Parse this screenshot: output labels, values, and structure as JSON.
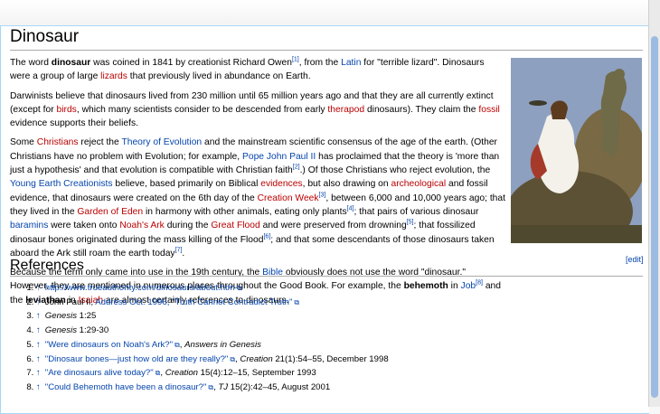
{
  "page": {
    "title": "Dinosaur"
  },
  "intro": {
    "p1_a": "The word ",
    "p1_b": "dinosaur",
    "p1_c": " was coined in 1841 by creationist Richard Owen",
    "p1_ref": "[1]",
    "p1_d": ", from the ",
    "p1_link_latin": "Latin",
    "p1_e": " for \"terrible lizard\". Dinosaurs were a group of large ",
    "p1_link_lizards": "lizards",
    "p1_f": " that previously lived in abundance on Earth.",
    "p2_a": "Darwinists believe that dinosaurs lived from 230 million until 65 million years ago and that they are all currently extinct (except for ",
    "p2_link_birds": "birds",
    "p2_b": ", which many scientists consider to be descended from early ",
    "p2_link_therapod": "therapod",
    "p2_c": " dinosaurs). They claim the ",
    "p2_link_fossil": "fossil",
    "p2_d": " evidence supports their beliefs.",
    "p3_a": "Some ",
    "p3_link_christians": "Christians",
    "p3_b": " reject the ",
    "p3_link_theory": "Theory of Evolution",
    "p3_c": " and the mainstream scientific consensus of the age of the earth. (Other Christians have no problem with Evolution; for example, ",
    "p3_link_pope": "Pope John Paul II",
    "p3_d": " has proclaimed that the theory is 'more than just a hypothesis' and that evolution is compatible with Christian faith",
    "p3_ref2": "[2]",
    "p3_e": ".) Of those Christians who reject evolution, the ",
    "p3_link_yec": "Young Earth Creationists",
    "p3_f": " believe, based primarily on Biblical ",
    "p3_link_evidences": "evidences",
    "p3_g": ", but also drawing on ",
    "p3_link_arch": "archeological",
    "p3_h": " and fossil evidence, that dinosaurs were created on the 6th day of the ",
    "p3_link_week": "Creation Week",
    "p3_ref3": "[3]",
    "p3_i": ", between 6,000 and 10,000 years ago; that they lived in the ",
    "p3_link_eden": "Garden of Eden",
    "p3_j": " in harmony with other animals, eating only plants",
    "p3_ref4": "[4]",
    "p3_k": "; that pairs of various dinosaur ",
    "p3_link_baramins": "baramins",
    "p3_l": " were taken onto ",
    "p3_link_ark": "Noah's Ark",
    "p3_m": " during the ",
    "p3_link_flood": "Great Flood",
    "p3_n": " and were preserved from drowning",
    "p3_ref5": "[5]",
    "p3_o": "; that fossilized dinosaur bones originated during the mass killing of the Flood",
    "p3_ref6": "[6]",
    "p3_p": "; and that some descendants of those dinosaurs taken aboard the Ark still roam the earth today",
    "p3_ref7": "[7]",
    "p3_q": ".",
    "p4_a": "Because the term only came into use in the 19th century, the ",
    "p4_link_bible": "Bible",
    "p4_b": " obviously does not use the word \"dinosaur.\" However, they are mentioned in numerous places throughout the Good Book. For example, the ",
    "p4_c": "behemoth",
    "p4_d": " in ",
    "p4_link_job": "Job",
    "p4_ref8": "[8]",
    "p4_e": " and the ",
    "p4_f": "leviathan",
    "p4_g": " in ",
    "p4_link_isaiah": "Isaiah",
    "p4_h": " are almost certainly references to dinosaurs."
  },
  "references": {
    "heading": "References",
    "edit_label": "[edit]",
    "arrow": "↑",
    "items": [
      {
        "link": "http://www.trueauthority.com/dinosaurs/about.htm"
      },
      {
        "pre": "John Paul II, ",
        "link": "Address Oct. 1996, \"Truth Cannot Contradict Truth\""
      },
      {
        "pre": "Genesis",
        "post": " 1:25"
      },
      {
        "pre": "Genesis",
        "post": " 1:29-30"
      },
      {
        "link": "\"Were dinosaurs on Noah's Ark?\"",
        "post": ", ",
        "italic": "Answers in Genesis"
      },
      {
        "link": "\"Dinosaur bones—just how old are they really?\"",
        "post": ", ",
        "italic": "Creation",
        "tail": " 21(1):54–55, December 1998"
      },
      {
        "link": "\"Are dinosaurs alive today?\"",
        "post": ", ",
        "italic": "Creation",
        "tail": " 15(4):12–15, September 1993"
      },
      {
        "link": "\"Could Behemoth have been a dinosaur?\"",
        "post": ", ",
        "italic": "TJ",
        "tail": " 15(2):42–45, August 2001"
      }
    ]
  },
  "colors": {
    "link": "#0645ad",
    "redlink": "#ba0000",
    "background": "#ffffff"
  }
}
